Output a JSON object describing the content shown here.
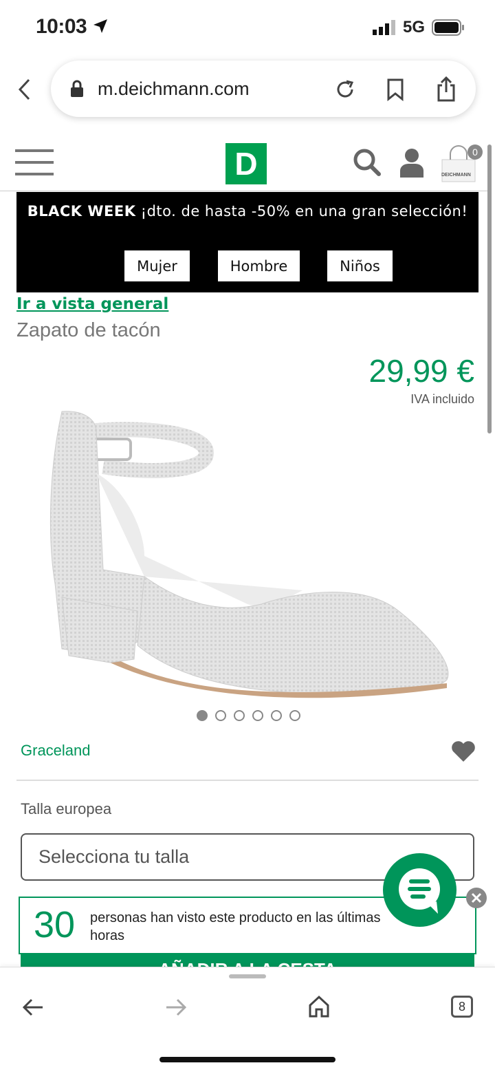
{
  "status": {
    "time": "10:03",
    "network": "5G"
  },
  "browser": {
    "url": "m.deichmann.com",
    "tabs_count": "8"
  },
  "header": {
    "logo": "D",
    "cart_count": "0",
    "cart_brand": "DEICHMANN"
  },
  "banner": {
    "highlight": "BLACK WEEK",
    "text": " ¡dto. de hasta -50% en una gran selección!",
    "buttons": [
      "Mujer",
      "Hombre",
      "Niños"
    ]
  },
  "product": {
    "overview_link": "Ir a vista general",
    "title": "Zapato de tacón",
    "price": "29,99 €",
    "vat": "IVA incluido",
    "image_dots": 6,
    "active_dot": 1,
    "brand": "Graceland",
    "size_label": "Talla europea",
    "size_placeholder": "Selecciona tu talla",
    "views_count": "30",
    "views_text": "personas han visto este producto en las últimas horas",
    "cart_button": "AÑADIR A LA CESTA"
  },
  "colors": {
    "brand_green": "#00955a",
    "banner_bg": "#000000"
  }
}
